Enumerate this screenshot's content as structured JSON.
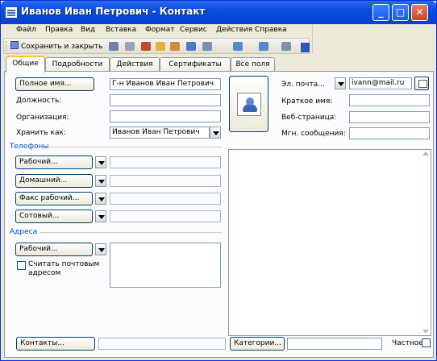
{
  "window": {
    "title": "Иванов Иван Петрович - Контакт",
    "controls": {
      "minimize": "_",
      "maximize": "□",
      "close": "✕"
    }
  },
  "menu": [
    "Файл",
    "Правка",
    "Вид",
    "Вставка",
    "Формат",
    "Сервис",
    "Действия",
    "Справка"
  ],
  "toolbar": {
    "save_close_label": "Сохранить и закрыть"
  },
  "tabs": [
    "Общие",
    "Подробности",
    "Действия",
    "Сертификаты",
    "Все поля"
  ],
  "general": {
    "full_name_button": "Полное имя...",
    "full_name_value": "Г-н Иванов Иван Петрович",
    "position_label": "Должность:",
    "organization_label": "Организация:",
    "save_as_label": "Хранить как:",
    "save_as_value": "Иванов Иван Петрович",
    "email_button": "Эл. почта...",
    "email_value": "ivann@mail.ru",
    "short_name_label": "Краткое имя:",
    "web_page_label": "Веб-страница:",
    "im_label": "Мгн. сообщения:"
  },
  "phones": {
    "section": "Телефоны",
    "buttons": [
      "Рабочий...",
      "Домашний...",
      "Факс рабочий...",
      "Сотовый..."
    ]
  },
  "addresses": {
    "section": "Адреса",
    "button": "Рабочий...",
    "mailing_checkbox": "Считать почтовым адресом"
  },
  "footer": {
    "contacts_button": "Контакты...",
    "categories_button": "Категории...",
    "private_label": "Частное"
  },
  "colors": {
    "title_gradient_top": "#2B6AEE",
    "window_bg": "#ECE9D8",
    "panel_bg": "#FCFCFE",
    "section_blue": "#0046D5",
    "tab_accent": "#FFC83C"
  }
}
